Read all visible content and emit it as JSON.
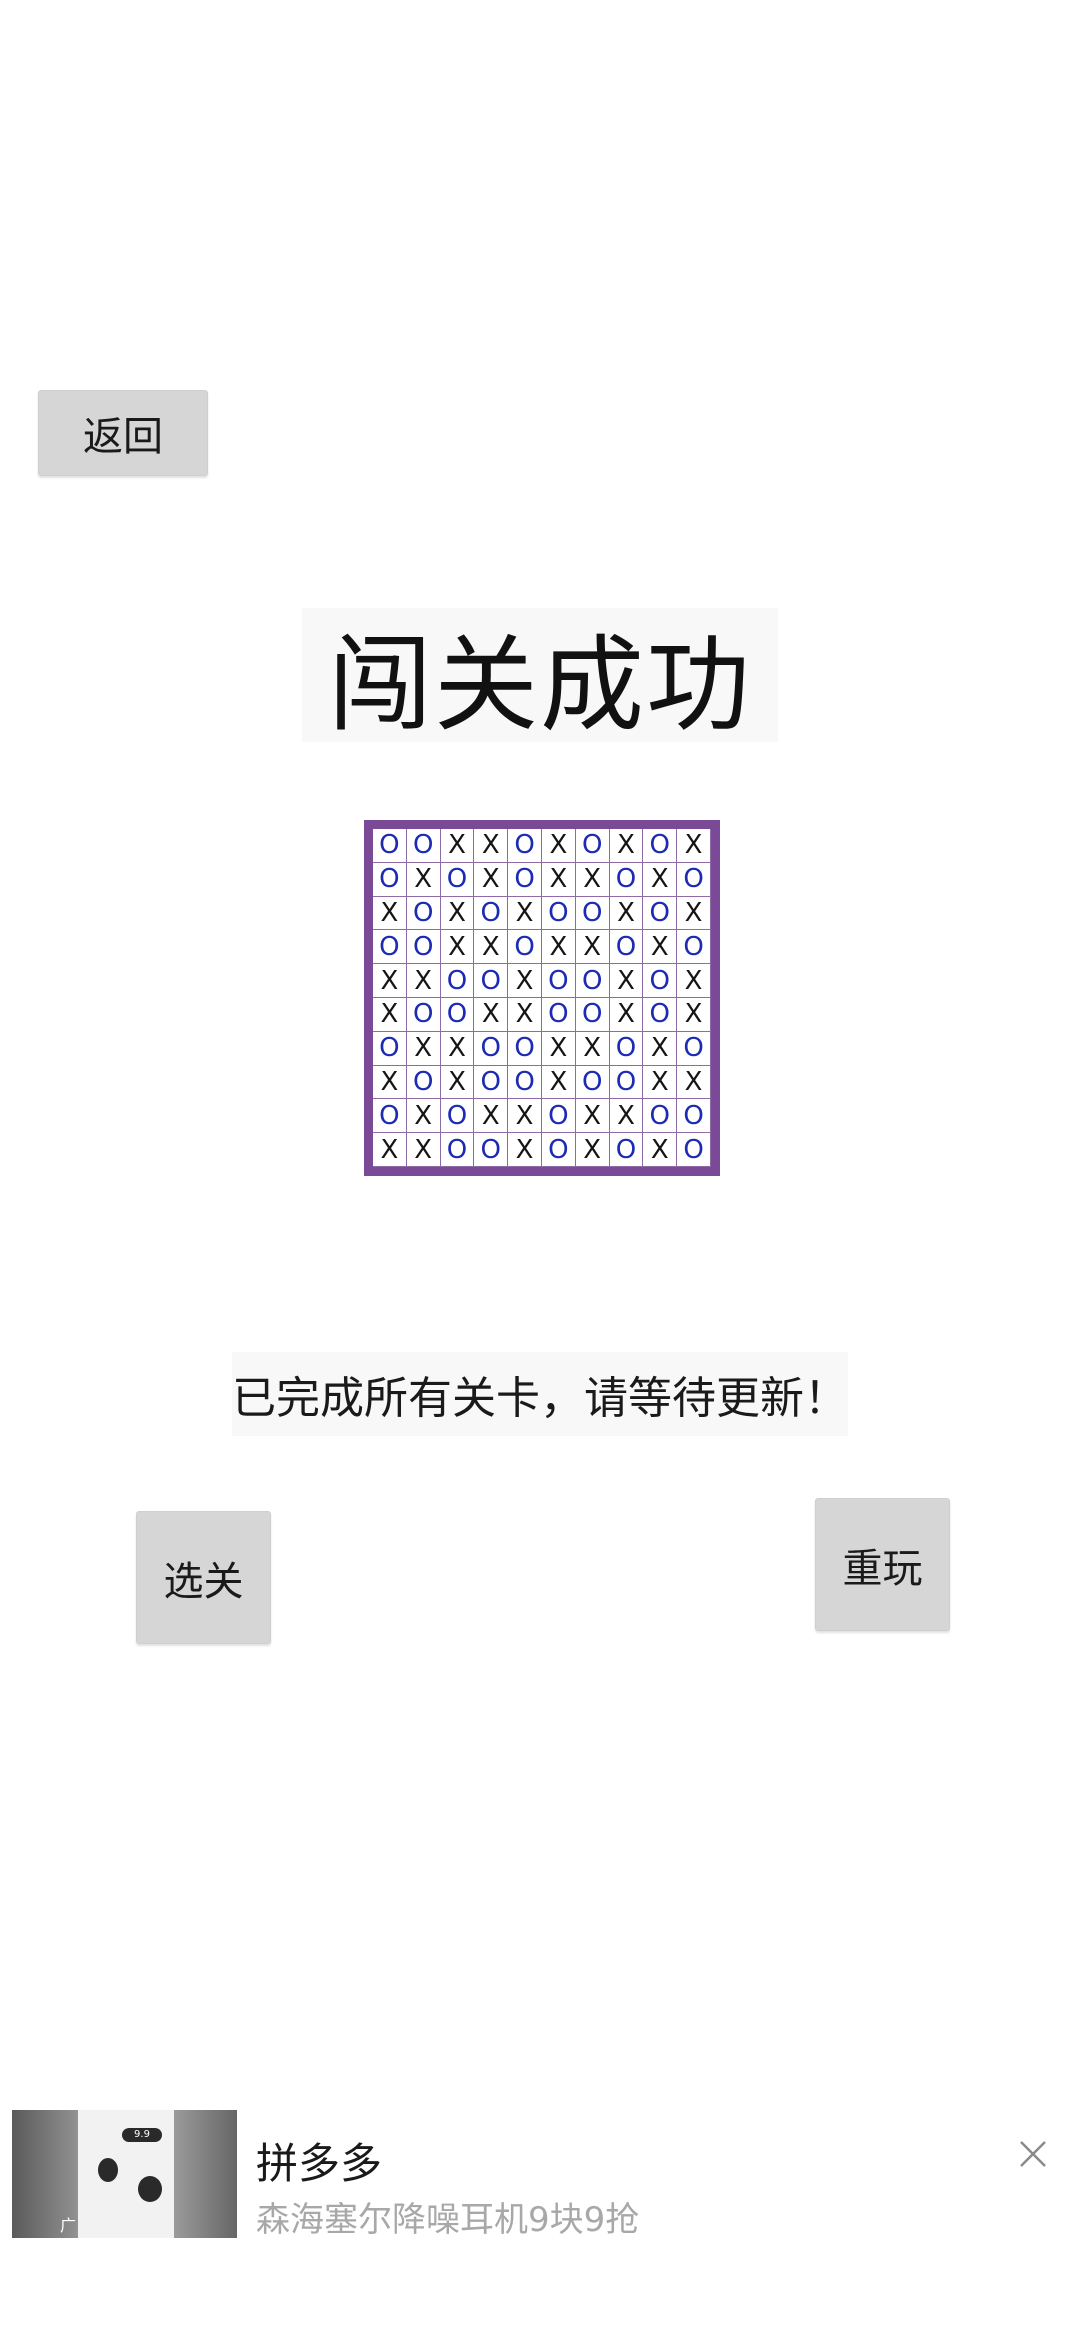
{
  "header": {
    "back_label": "返回"
  },
  "result": {
    "title": "闯关成功",
    "message": "已完成所有关卡，请等待更新！"
  },
  "board": {
    "rows": [
      [
        "O",
        "O",
        "X",
        "X",
        "O",
        "X",
        "O",
        "X",
        "O",
        "X"
      ],
      [
        "O",
        "X",
        "O",
        "X",
        "O",
        "X",
        "X",
        "O",
        "X",
        "O"
      ],
      [
        "X",
        "O",
        "X",
        "O",
        "X",
        "O",
        "O",
        "X",
        "O",
        "X"
      ],
      [
        "O",
        "O",
        "X",
        "X",
        "O",
        "X",
        "X",
        "O",
        "X",
        "O"
      ],
      [
        "X",
        "X",
        "O",
        "O",
        "X",
        "O",
        "O",
        "X",
        "O",
        "X"
      ],
      [
        "X",
        "O",
        "O",
        "X",
        "X",
        "O",
        "O",
        "X",
        "O",
        "X"
      ],
      [
        "O",
        "X",
        "X",
        "O",
        "O",
        "X",
        "X",
        "O",
        "X",
        "O"
      ],
      [
        "X",
        "O",
        "X",
        "O",
        "O",
        "X",
        "O",
        "O",
        "X",
        "X"
      ],
      [
        "O",
        "X",
        "O",
        "X",
        "X",
        "O",
        "X",
        "X",
        "O",
        "O"
      ],
      [
        "X",
        "X",
        "O",
        "O",
        "X",
        "O",
        "X",
        "O",
        "X",
        "O"
      ]
    ],
    "colors": {
      "border": "#7a4a97",
      "o_color": "#1d2bb4",
      "x_color": "#151515"
    }
  },
  "actions": {
    "select_label": "选关",
    "replay_label": "重玩"
  },
  "ad": {
    "title": "拼多多",
    "description": "森海塞尔降噪耳机9块9抢",
    "thumb_price": "9.9",
    "thumb_label": "广",
    "close_icon": "close-icon"
  }
}
